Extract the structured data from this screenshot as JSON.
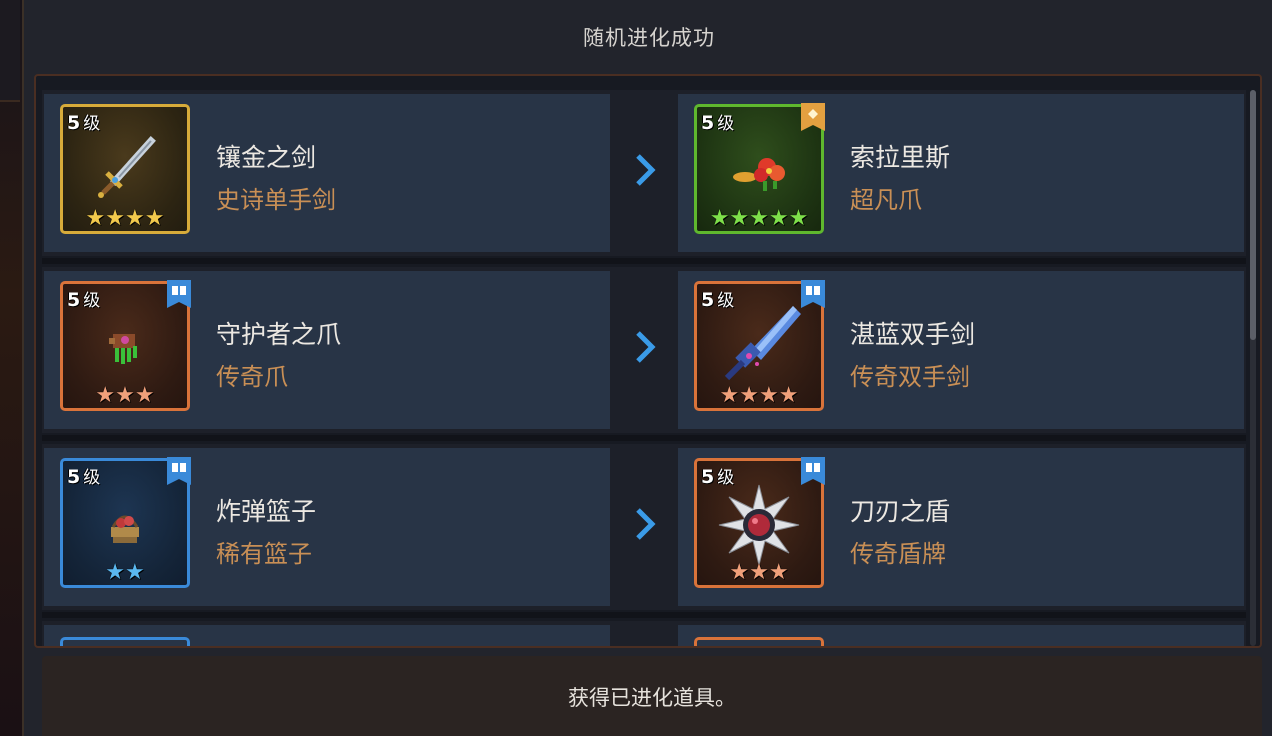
{
  "title": "随机进化成功",
  "footer": "获得已进化道具。",
  "level_unit": "级",
  "colors": {
    "gold": "#d7ab3a",
    "green": "#5fb82e",
    "orange": "#d9733a",
    "blue": "#3a8ad9",
    "type_text": "#c98f55",
    "arrow": "#3a9be8"
  },
  "rows": [
    {
      "from": {
        "level": "5",
        "name": "镶金之剑",
        "type": "史诗单手剑",
        "stars": 4,
        "rarity": "gold",
        "icon": "sword-icon",
        "badge": null
      },
      "to": {
        "level": "5",
        "name": "索拉里斯",
        "type": "超凡爪",
        "stars": 5,
        "rarity": "green",
        "icon": "flower-claw-icon",
        "badge": "gold-diamond-badge"
      }
    },
    {
      "from": {
        "level": "5",
        "name": "守护者之爪",
        "type": "传奇爪",
        "stars": 3,
        "rarity": "orange",
        "icon": "claw-icon",
        "badge": "book-badge"
      },
      "to": {
        "level": "5",
        "name": "湛蓝双手剑",
        "type": "传奇双手剑",
        "stars": 4,
        "rarity": "orange",
        "icon": "greatsword-icon",
        "badge": "book-badge"
      }
    },
    {
      "from": {
        "level": "5",
        "name": "炸弹篮子",
        "type": "稀有篮子",
        "stars": 2,
        "rarity": "blue",
        "icon": "bomb-basket-icon",
        "badge": "book-badge"
      },
      "to": {
        "level": "5",
        "name": "刀刃之盾",
        "type": "传奇盾牌",
        "stars": 3,
        "rarity": "orange",
        "icon": "blade-shield-icon",
        "badge": "book-badge"
      }
    }
  ]
}
